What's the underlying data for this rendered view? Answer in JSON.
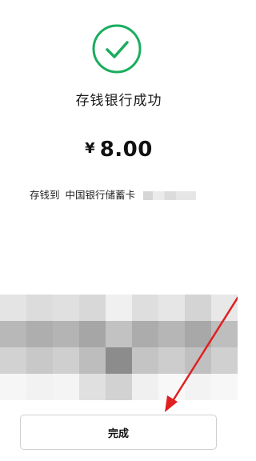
{
  "result": {
    "icon": "checkmark-circle-icon",
    "accent_color": "#1aad5e",
    "title": "存钱银行成功"
  },
  "amount": {
    "currency": "¥",
    "value": "8.00"
  },
  "deposit": {
    "label": "存钱到",
    "bank": "中国银行储蓄卡",
    "card_suffix_masked": "（…）"
  },
  "actions": {
    "done_label": "完成"
  },
  "annotation": {
    "arrow_color": "#e02020"
  }
}
